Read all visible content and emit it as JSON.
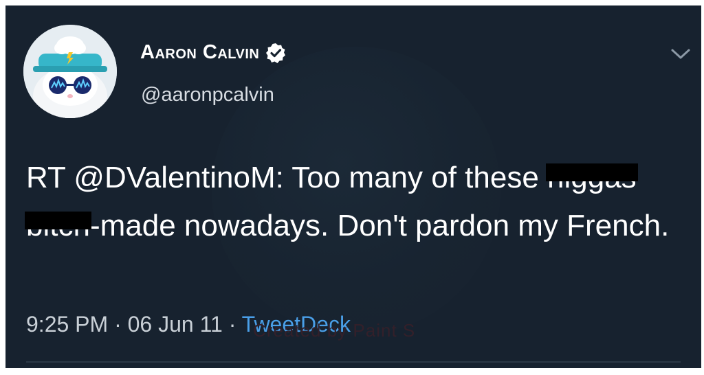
{
  "tweet": {
    "author_name": "Aaron Calvin",
    "handle": "@aaronpcalvin",
    "text_before": "RT @DValentinoM: Too many of these ",
    "redacted_word_1": "niggas",
    "redacted_word_2": "bitch",
    "text_after": "-made nowadays. Don't pardon my French.",
    "time": "9:25 PM",
    "separator": "·",
    "date": "06 Jun 11",
    "source": "TweetDeck"
  },
  "watermark": {
    "text": "Created by Paint S"
  },
  "icons": {
    "verified": "verified-badge-icon",
    "more": "chevron-down-icon"
  },
  "colors": {
    "background": "#17222f",
    "text": "#ffffff",
    "muted": "#c9d0d7",
    "link": "#4a9fe8"
  }
}
